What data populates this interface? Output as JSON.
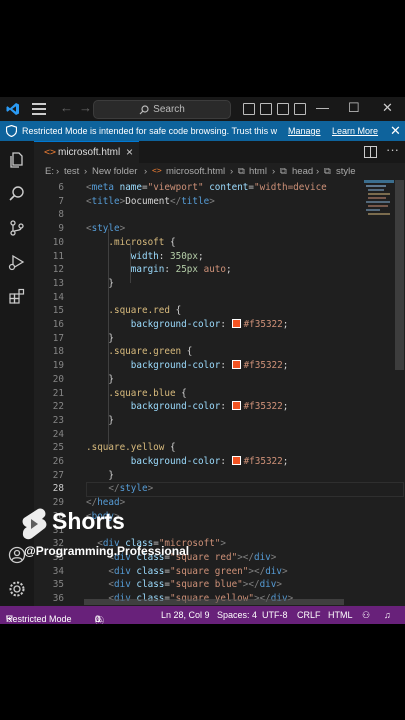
{
  "titlebar": {
    "search_label": "Search"
  },
  "banner": {
    "message": "Restricted Mode is intended for safe code browsing. Trust this wi...",
    "manage": "Manage",
    "learn_more": "Learn More"
  },
  "tab": {
    "label": "microsoft.html",
    "close": "×"
  },
  "breadcrumb": {
    "items": [
      "E:",
      "test",
      "New folder",
      "microsoft.html",
      "html",
      "head",
      "style"
    ]
  },
  "code": {
    "lines": [
      {
        "n": "6",
        "html": "<span class='t-br'>&lt;</span><span class='t-tag'>meta</span> <span class='t-attr'>name</span>=<span class='t-str'>\"viewport\"</span> <span class='t-attr'>content</span>=<span class='t-str'>\"width=device</span>"
      },
      {
        "n": "7",
        "html": "<span class='t-br'>&lt;</span><span class='t-tag'>title</span><span class='t-br'>&gt;</span><span class='t-txt'>Document</span><span class='t-br'>&lt;/</span><span class='t-tag'>title</span><span class='t-br'>&gt;</span>"
      },
      {
        "n": "8",
        "html": ""
      },
      {
        "n": "9",
        "html": "<span class='t-br'>&lt;</span><span class='t-tag'>style</span><span class='t-br'>&gt;</span>"
      },
      {
        "n": "10",
        "html": "    <span class='t-sel'>.microsoft</span> <span class='t-txt'>{</span>"
      },
      {
        "n": "11",
        "html": "        <span class='t-prop'>width</span><span class='t-txt'>:</span> <span class='t-num'>350px</span><span class='t-txt'>;</span>"
      },
      {
        "n": "12",
        "html": "        <span class='t-prop'>margin</span><span class='t-txt'>:</span> <span class='t-num'>25px</span> <span class='t-val'>auto</span><span class='t-txt'>;</span>"
      },
      {
        "n": "13",
        "html": "    <span class='t-txt'>}</span>"
      },
      {
        "n": "14",
        "html": ""
      },
      {
        "n": "15",
        "html": "    <span class='t-sel'>.square.red</span> <span class='t-txt'>{</span>"
      },
      {
        "n": "16",
        "html": "        <span class='t-prop'>background-color</span><span class='t-txt'>:</span> <span class='swatch'></span><span class='t-val'>#f35322</span><span class='t-txt'>;</span>"
      },
      {
        "n": "17",
        "html": "    <span class='t-txt'>}</span>"
      },
      {
        "n": "18",
        "html": "    <span class='t-sel'>.square.green</span> <span class='t-txt'>{</span>"
      },
      {
        "n": "19",
        "html": "        <span class='t-prop'>background-color</span><span class='t-txt'>:</span> <span class='swatch'></span><span class='t-val'>#f35322</span><span class='t-txt'>;</span>"
      },
      {
        "n": "20",
        "html": "    <span class='t-txt'>}</span>"
      },
      {
        "n": "21",
        "html": "    <span class='t-sel'>.square.blue</span> <span class='t-txt'>{</span>"
      },
      {
        "n": "22",
        "html": "        <span class='t-prop'>background-color</span><span class='t-txt'>:</span> <span class='swatch'></span><span class='t-val'>#f35322</span><span class='t-txt'>;</span>"
      },
      {
        "n": "23",
        "html": "    <span class='t-txt'>}</span>"
      },
      {
        "n": "24",
        "html": ""
      },
      {
        "n": "25",
        "html": "<span class='t-sel'>.square.yellow</span> <span class='t-txt'>{</span>"
      },
      {
        "n": "26",
        "html": "        <span class='t-prop'>background-color</span><span class='t-txt'>:</span> <span class='swatch'></span><span class='t-val'>#f35322</span><span class='t-txt'>;</span>"
      },
      {
        "n": "27",
        "html": "    <span class='t-txt'>}</span>"
      },
      {
        "n": "28",
        "html": "    <span class='t-br'>&lt;/</span><span class='t-tag'>style</span><span class='t-br'>&gt;</span>"
      },
      {
        "n": "29",
        "html": "<span class='t-br'>&lt;/</span><span class='t-tag'>head</span><span class='t-br'>&gt;</span>"
      },
      {
        "n": "30",
        "html": "<span class='t-br'>&lt;</span><span class='t-tag'>body</span><span class='t-br'>&gt;</span>"
      },
      {
        "n": "31",
        "html": ""
      },
      {
        "n": "32",
        "html": "  <span class='t-br'>&lt;</span><span class='t-tag'>div</span> <span class='t-attr'>class</span>=<span class='t-str'>\"microsoft\"</span><span class='t-br'>&gt;</span>"
      },
      {
        "n": "33",
        "html": "    <span class='t-br'>&lt;</span><span class='t-tag'>div</span> <span class='t-attr'>class</span>=<span class='t-str'>\"square red\"</span><span class='t-br'>&gt;&lt;/</span><span class='t-tag'>div</span><span class='t-br'>&gt;</span>"
      },
      {
        "n": "34",
        "html": "    <span class='t-br'>&lt;</span><span class='t-tag'>div</span> <span class='t-attr'>class</span>=<span class='t-str'>\"square green\"</span><span class='t-br'>&gt;&lt;/</span><span class='t-tag'>div</span><span class='t-br'>&gt;</span>"
      },
      {
        "n": "35",
        "html": "    <span class='t-br'>&lt;</span><span class='t-tag'>div</span> <span class='t-attr'>class</span>=<span class='t-str'>\"square blue\"</span><span class='t-br'>&gt;&lt;/</span><span class='t-tag'>div</span><span class='t-br'>&gt;</span>"
      },
      {
        "n": "36",
        "html": "    <span class='t-br'>&lt;</span><span class='t-tag'>div</span> <span class='t-attr'>class</span>=<span class='t-str'>\"square yellow\"</span><span class='t-br'>&gt;&lt;/</span><span class='t-tag'>div</span><span class='t-br'>&gt;</span>"
      }
    ],
    "current_line": "28"
  },
  "statusbar": {
    "mode": "Restricted Mode",
    "problems": "0",
    "warnings": "0",
    "position": "Ln 28, Col 9",
    "spaces": "Spaces: 4",
    "encoding": "UTF-8",
    "eol": "CRLF",
    "language": "HTML"
  },
  "overlay": {
    "shorts": "Shorts",
    "channel": "@Programming.Professional"
  },
  "colors": {
    "banner": "#0e639c",
    "statusbar": "#68217a",
    "swatch": "#f35322"
  }
}
